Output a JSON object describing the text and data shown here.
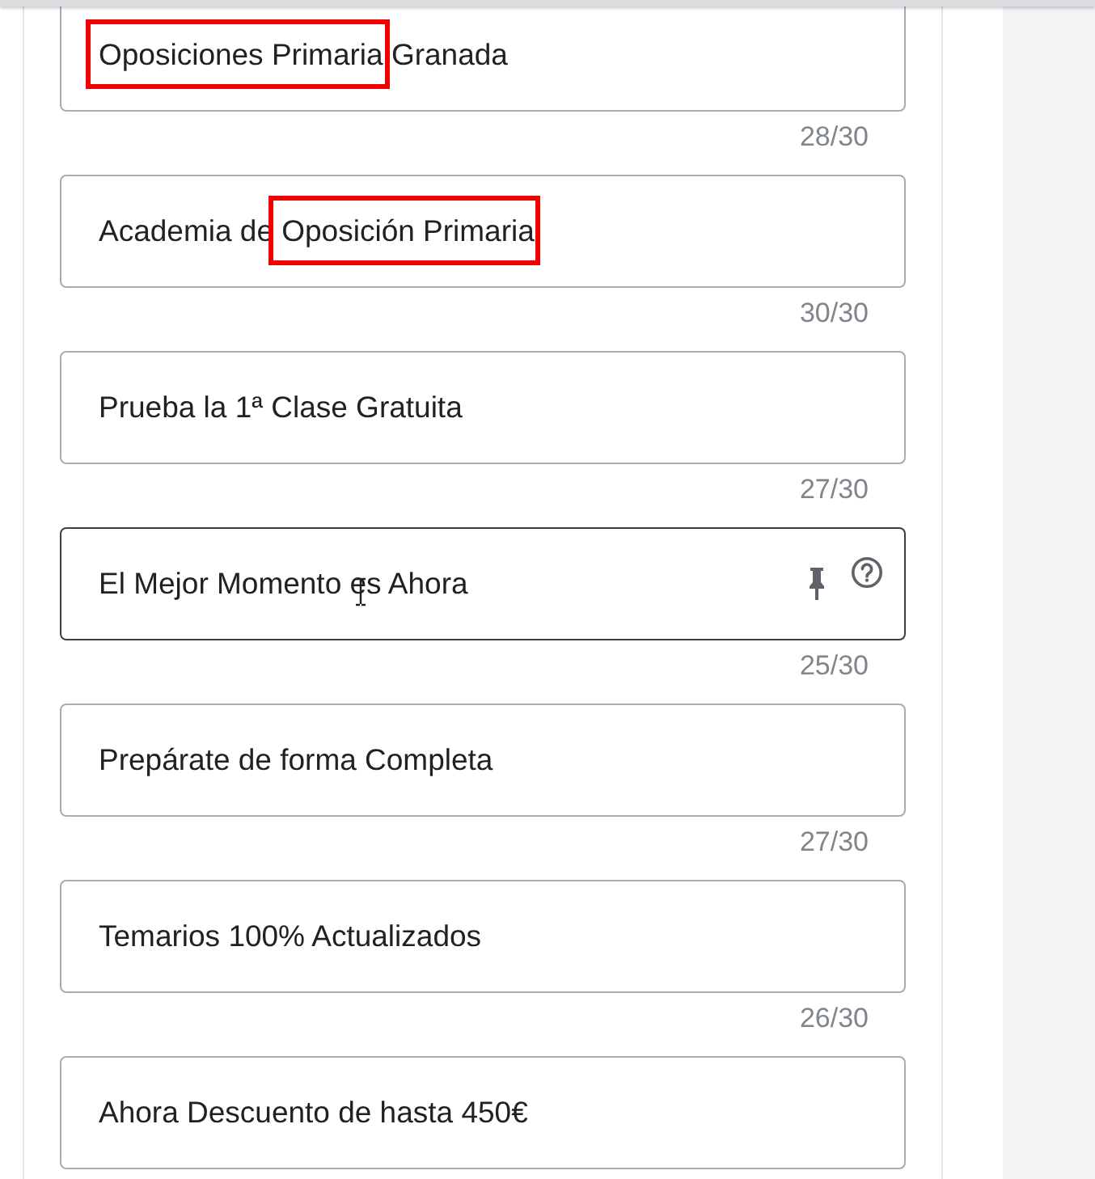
{
  "headlines": [
    {
      "segments": [
        {
          "text": "Oposiciones Primaria",
          "boxed": true
        },
        {
          "text": " Granada",
          "boxed": false
        }
      ],
      "hovered": false,
      "counter": "28/30"
    },
    {
      "segments": [
        {
          "text": "Academia de ",
          "boxed": false
        },
        {
          "text": "Oposición Primaria",
          "boxed": true
        }
      ],
      "hovered": false,
      "counter": "30/30"
    },
    {
      "segments": [
        {
          "text": "Prueba la 1ª Clase Gratuita",
          "boxed": false
        }
      ],
      "hovered": false,
      "counter": "27/30"
    },
    {
      "segments": [
        {
          "text": "El Mejor Momento es Ahora",
          "boxed": false
        }
      ],
      "hovered": true,
      "counter": "25/30"
    },
    {
      "segments": [
        {
          "text": "Prepárate de forma Completa",
          "boxed": false
        }
      ],
      "hovered": false,
      "counter": "27/30"
    },
    {
      "segments": [
        {
          "text": "Temarios 100% Actualizados",
          "boxed": false
        }
      ],
      "hovered": false,
      "counter": "26/30"
    },
    {
      "segments": [
        {
          "text": "Ahora Descuento de hasta 450€",
          "boxed": false
        }
      ],
      "hovered": false
    }
  ]
}
